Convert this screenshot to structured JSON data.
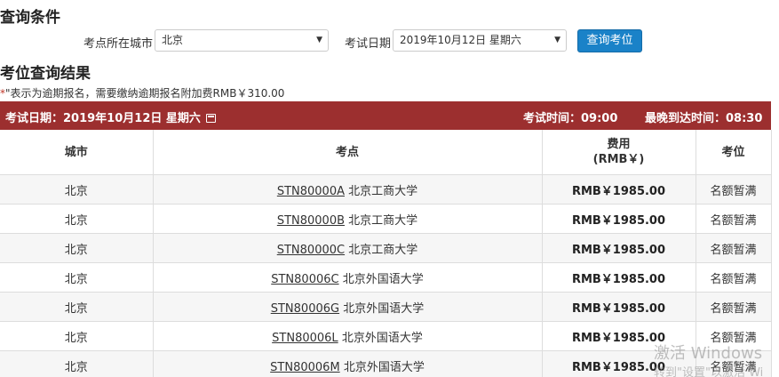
{
  "search": {
    "title": "查询条件",
    "city_label": "考点所在城市",
    "city_value": "北京",
    "date_label": "考试日期",
    "date_value": "2019年10月12日 星期六",
    "query_button": "查询考位"
  },
  "results": {
    "title": "考位查询结果",
    "late_note_star": "*",
    "late_note": "\"表示为逾期报名，需要缴纳逾期报名附加费RMB￥310.00",
    "exam_date_text": "考试日期：2019年10月12日 星期六",
    "exam_time_text": "考试时间：09:00",
    "arrival_time_text": "最晚到达时间：08:30",
    "columns": [
      "城市",
      "考点",
      "费用",
      "(RMB￥)",
      "考位"
    ],
    "rows": [
      {
        "city": "北京",
        "code": "STN80000A",
        "name": "北京工商大学",
        "fee": "RMB￥1985.00",
        "seat": "名额暂满"
      },
      {
        "city": "北京",
        "code": "STN80000B",
        "name": "北京工商大学",
        "fee": "RMB￥1985.00",
        "seat": "名额暂满"
      },
      {
        "city": "北京",
        "code": "STN80000C",
        "name": "北京工商大学",
        "fee": "RMB￥1985.00",
        "seat": "名额暂满"
      },
      {
        "city": "北京",
        "code": "STN80006C",
        "name": "北京外国语大学",
        "fee": "RMB￥1985.00",
        "seat": "名额暂满"
      },
      {
        "city": "北京",
        "code": "STN80006G",
        "name": "北京外国语大学",
        "fee": "RMB￥1985.00",
        "seat": "名额暂满"
      },
      {
        "city": "北京",
        "code": "STN80006L",
        "name": "北京外国语大学",
        "fee": "RMB￥1985.00",
        "seat": "名额暂满"
      },
      {
        "city": "北京",
        "code": "STN80006M",
        "name": "北京外国语大学",
        "fee": "RMB￥1985.00",
        "seat": "名额暂满"
      }
    ]
  },
  "watermark": {
    "line1": "激活 Windows",
    "line2": "转到\"设置\"以激活 Wi"
  }
}
